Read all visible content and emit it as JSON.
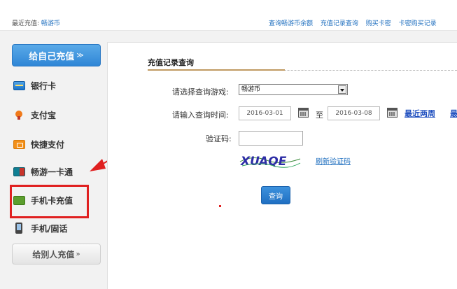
{
  "topbar": {
    "recent_label": "最近充值:",
    "recent_value": "畅游币",
    "links": [
      "查询畅游币余额",
      "充值记录查询",
      "购买卡密",
      "卡密购买记录"
    ]
  },
  "sidebar": {
    "top_button": "给自己充值",
    "top_button_chevron": "≫",
    "items": [
      {
        "label": "银行卡",
        "icon": "bank-card-icon"
      },
      {
        "label": "支付宝",
        "icon": "alipay-icon"
      },
      {
        "label": "快捷支付",
        "icon": "quick-pay-icon"
      },
      {
        "label": "畅游一卡通",
        "icon": "changyou-card-icon"
      },
      {
        "label": "手机卡充值",
        "icon": "mobile-card-icon"
      },
      {
        "label": "手机/固话",
        "icon": "phone-icon"
      }
    ],
    "bottom_button": "给别人充值",
    "bottom_button_chevron": "»"
  },
  "main": {
    "title": "充值记录查询",
    "game_label": "请选择查询游戏:",
    "game_value": "畅游币",
    "time_label": "请输入查询时间:",
    "date_start": "2016-03-01",
    "date_sep": "至",
    "date_end": "2016-03-08",
    "quick_range_1": "最近两周",
    "quick_range_2": "最",
    "captcha_label": "验证码:",
    "captcha_value": "",
    "captcha_text": "XUAQE",
    "refresh_label": "刷新验证码",
    "query_button": "查询"
  },
  "colors": {
    "accent": "#2f86d6",
    "link": "#1f6fbf",
    "highlight": "#e02020"
  }
}
